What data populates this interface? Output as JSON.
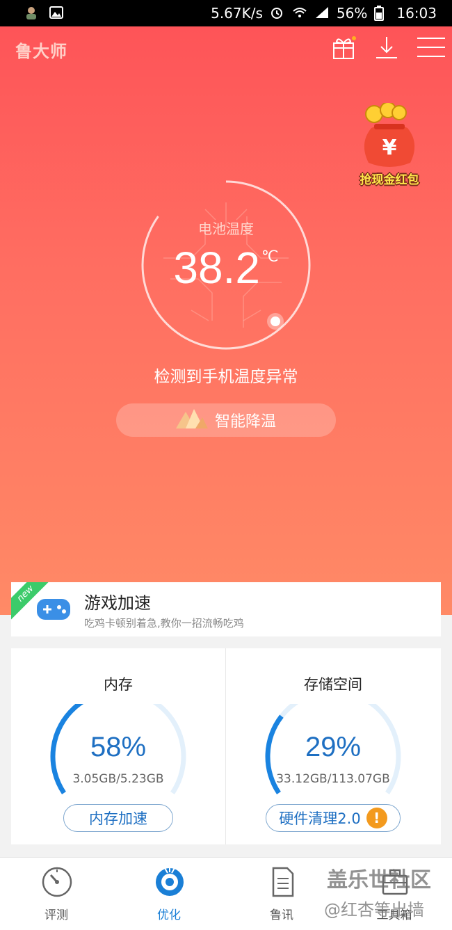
{
  "status_bar": {
    "network_speed": "5.67K/s",
    "battery": "56%",
    "time": "16:03"
  },
  "header": {
    "logo": "鲁大师"
  },
  "promo": {
    "label": "抢现金红包"
  },
  "gauge": {
    "label": "电池温度",
    "value": "38.2",
    "unit": "℃"
  },
  "alert": {
    "text": "检测到手机温度异常"
  },
  "cool_button": {
    "label": "智能降温"
  },
  "game_boost": {
    "badge": "new",
    "title": "游戏加速",
    "subtitle": "吃鸡卡顿别着急,教你一招流畅吃鸡"
  },
  "memory": {
    "title": "内存",
    "percent": "58%",
    "usage": "3.05GB/5.23GB",
    "button": "内存加速",
    "fraction": 0.58
  },
  "storage": {
    "title": "存储空间",
    "percent": "29%",
    "usage": "33.12GB/113.07GB",
    "button": "硬件清理2.0",
    "badge": "!",
    "fraction": 0.29
  },
  "tabs": [
    {
      "label": "评测",
      "icon": "speedometer-icon"
    },
    {
      "label": "优化",
      "icon": "optimize-icon"
    },
    {
      "label": "鲁讯",
      "icon": "document-icon"
    },
    {
      "label": "工具箱",
      "icon": "toolbox-icon"
    }
  ],
  "watermark": {
    "line1": "盖乐世社区",
    "line2": "@红杏等出墙"
  },
  "colors": {
    "hero_top": "#fe5458",
    "hero_bottom": "#ff8a66",
    "accent_blue": "#1e6fc2",
    "ring_track": "#e3f0fb"
  }
}
